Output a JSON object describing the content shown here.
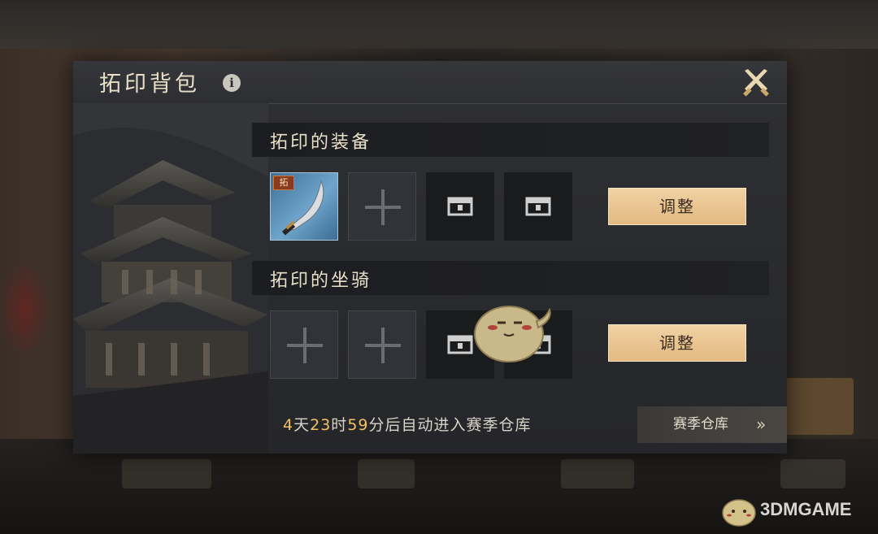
{
  "panel": {
    "title": "拓印背包",
    "info_icon": "info-icon",
    "close_icon": "crossed-swords-close-icon"
  },
  "sections": [
    {
      "title": "拓印的装备",
      "slots": [
        "filled",
        "empty",
        "locked",
        "locked"
      ],
      "filled_badge": "拓",
      "adjust_label": "调整"
    },
    {
      "title": "拓印的坐骑",
      "slots": [
        "empty",
        "empty",
        "locked",
        "locked"
      ],
      "adjust_label": "调整"
    }
  ],
  "footer": {
    "countdown_days": "4",
    "countdown_days_unit": "天",
    "countdown_hours": "23",
    "countdown_hours_unit": "时",
    "countdown_minutes": "59",
    "countdown_minutes_unit": "分",
    "countdown_suffix": "后自动进入赛季仓库",
    "season_button_label": "赛季仓库",
    "season_button_chevron": "»"
  },
  "watermark": "3DMGAME",
  "colors": {
    "accent_gold": "#f1c163",
    "button_tan": "#e3b982",
    "title_cream": "#e8dfc8"
  }
}
